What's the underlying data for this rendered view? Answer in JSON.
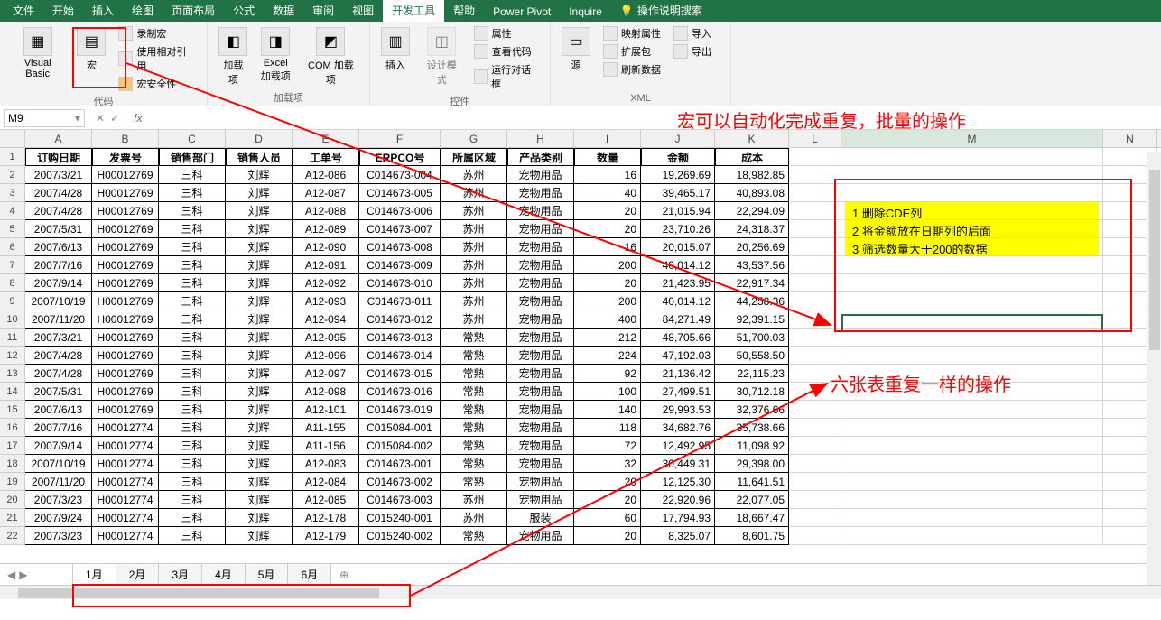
{
  "tabs": [
    "文件",
    "开始",
    "插入",
    "绘图",
    "页面布局",
    "公式",
    "数据",
    "审阅",
    "视图",
    "开发工具",
    "帮助",
    "Power Pivot",
    "Inquire"
  ],
  "activeTab": "开发工具",
  "tellme_placeholder": "操作说明搜索",
  "ribbon": {
    "g1": {
      "label": "代码",
      "vbasic": "Visual Basic",
      "macro": "宏",
      "items": [
        "录制宏",
        "使用相对引用",
        "宏安全性"
      ]
    },
    "g2": {
      "label": "加载项",
      "addin": "加载项",
      "excel_addin": "Excel\n加载项",
      "com_addin": "COM 加载项"
    },
    "g3": {
      "label": "控件",
      "insert": "插入",
      "design": "设计模式",
      "items": [
        "属性",
        "查看代码",
        "运行对话框"
      ]
    },
    "g4": {
      "label": "XML",
      "source": "源",
      "items": [
        "映射属性",
        "扩展包",
        "刷新数据"
      ],
      "items2": [
        "导入",
        "导出"
      ]
    }
  },
  "namebox": "M9",
  "columns": [
    "A",
    "B",
    "C",
    "D",
    "E",
    "F",
    "G",
    "H",
    "I",
    "J",
    "K",
    "L",
    "M",
    "N"
  ],
  "headers": [
    "订购日期",
    "发票号",
    "销售部门",
    "销售人员",
    "工单号",
    "ERPCO号",
    "所属区域",
    "产品类别",
    "数量",
    "金额",
    "成本"
  ],
  "rows": [
    [
      "2007/3/21",
      "H00012769",
      "三科",
      "刘辉",
      "A12-086",
      "C014673-004",
      "苏州",
      "宠物用品",
      "16",
      "19,269.69",
      "18,982.85"
    ],
    [
      "2007/4/28",
      "H00012769",
      "三科",
      "刘辉",
      "A12-087",
      "C014673-005",
      "苏州",
      "宠物用品",
      "40",
      "39,465.17",
      "40,893.08"
    ],
    [
      "2007/4/28",
      "H00012769",
      "三科",
      "刘辉",
      "A12-088",
      "C014673-006",
      "苏州",
      "宠物用品",
      "20",
      "21,015.94",
      "22,294.09"
    ],
    [
      "2007/5/31",
      "H00012769",
      "三科",
      "刘辉",
      "A12-089",
      "C014673-007",
      "苏州",
      "宠物用品",
      "20",
      "23,710.26",
      "24,318.37"
    ],
    [
      "2007/6/13",
      "H00012769",
      "三科",
      "刘辉",
      "A12-090",
      "C014673-008",
      "苏州",
      "宠物用品",
      "16",
      "20,015.07",
      "20,256.69"
    ],
    [
      "2007/7/16",
      "H00012769",
      "三科",
      "刘辉",
      "A12-091",
      "C014673-009",
      "苏州",
      "宠物用品",
      "200",
      "40,014.12",
      "43,537.56"
    ],
    [
      "2007/9/14",
      "H00012769",
      "三科",
      "刘辉",
      "A12-092",
      "C014673-010",
      "苏州",
      "宠物用品",
      "20",
      "21,423.95",
      "22,917.34"
    ],
    [
      "2007/10/19",
      "H00012769",
      "三科",
      "刘辉",
      "A12-093",
      "C014673-011",
      "苏州",
      "宠物用品",
      "200",
      "40,014.12",
      "44,258.36"
    ],
    [
      "2007/11/20",
      "H00012769",
      "三科",
      "刘辉",
      "A12-094",
      "C014673-012",
      "苏州",
      "宠物用品",
      "400",
      "84,271.49",
      "92,391.15"
    ],
    [
      "2007/3/21",
      "H00012769",
      "三科",
      "刘辉",
      "A12-095",
      "C014673-013",
      "常熟",
      "宠物用品",
      "212",
      "48,705.66",
      "51,700.03"
    ],
    [
      "2007/4/28",
      "H00012769",
      "三科",
      "刘辉",
      "A12-096",
      "C014673-014",
      "常熟",
      "宠物用品",
      "224",
      "47,192.03",
      "50,558.50"
    ],
    [
      "2007/4/28",
      "H00012769",
      "三科",
      "刘辉",
      "A12-097",
      "C014673-015",
      "常熟",
      "宠物用品",
      "92",
      "21,136.42",
      "22,115.23"
    ],
    [
      "2007/5/31",
      "H00012769",
      "三科",
      "刘辉",
      "A12-098",
      "C014673-016",
      "常熟",
      "宠物用品",
      "100",
      "27,499.51",
      "30,712.18"
    ],
    [
      "2007/6/13",
      "H00012769",
      "三科",
      "刘辉",
      "A12-101",
      "C014673-019",
      "常熟",
      "宠物用品",
      "140",
      "29,993.53",
      "32,376.66"
    ],
    [
      "2007/7/16",
      "H00012774",
      "三科",
      "刘辉",
      "A11-155",
      "C015084-001",
      "常熟",
      "宠物用品",
      "118",
      "34,682.76",
      "35,738.66"
    ],
    [
      "2007/9/14",
      "H00012774",
      "三科",
      "刘辉",
      "A11-156",
      "C015084-002",
      "常熟",
      "宠物用品",
      "72",
      "12,492.95",
      "11,098.92"
    ],
    [
      "2007/10/19",
      "H00012774",
      "三科",
      "刘辉",
      "A12-083",
      "C014673-001",
      "常熟",
      "宠物用品",
      "32",
      "30,449.31",
      "29,398.00"
    ],
    [
      "2007/11/20",
      "H00012774",
      "三科",
      "刘辉",
      "A12-084",
      "C014673-002",
      "常熟",
      "宠物用品",
      "20",
      "12,125.30",
      "11,641.51"
    ],
    [
      "2007/3/23",
      "H00012774",
      "三科",
      "刘辉",
      "A12-085",
      "C014673-003",
      "苏州",
      "宠物用品",
      "20",
      "22,920.96",
      "22,077.05"
    ],
    [
      "2007/9/24",
      "H00012774",
      "三科",
      "刘辉",
      "A12-178",
      "C015240-001",
      "苏州",
      "服装",
      "60",
      "17,794.93",
      "18,667.47"
    ],
    [
      "2007/3/23",
      "H00012774",
      "三科",
      "刘辉",
      "A12-179",
      "C015240-002",
      "常熟",
      "宠物用品",
      "20",
      "8,325.07",
      "8,601.75"
    ]
  ],
  "notes": [
    "1 删除CDE列",
    "2 将金额放在日期列的后面",
    "3 筛选数量大于200的数据"
  ],
  "anno1": "宏可以自动化完成重复，批量的操作",
  "anno2": "六张表重复一样的操作",
  "sheets": [
    "1月",
    "2月",
    "3月",
    "4月",
    "5月",
    "6月"
  ],
  "activeSheet": "1月"
}
